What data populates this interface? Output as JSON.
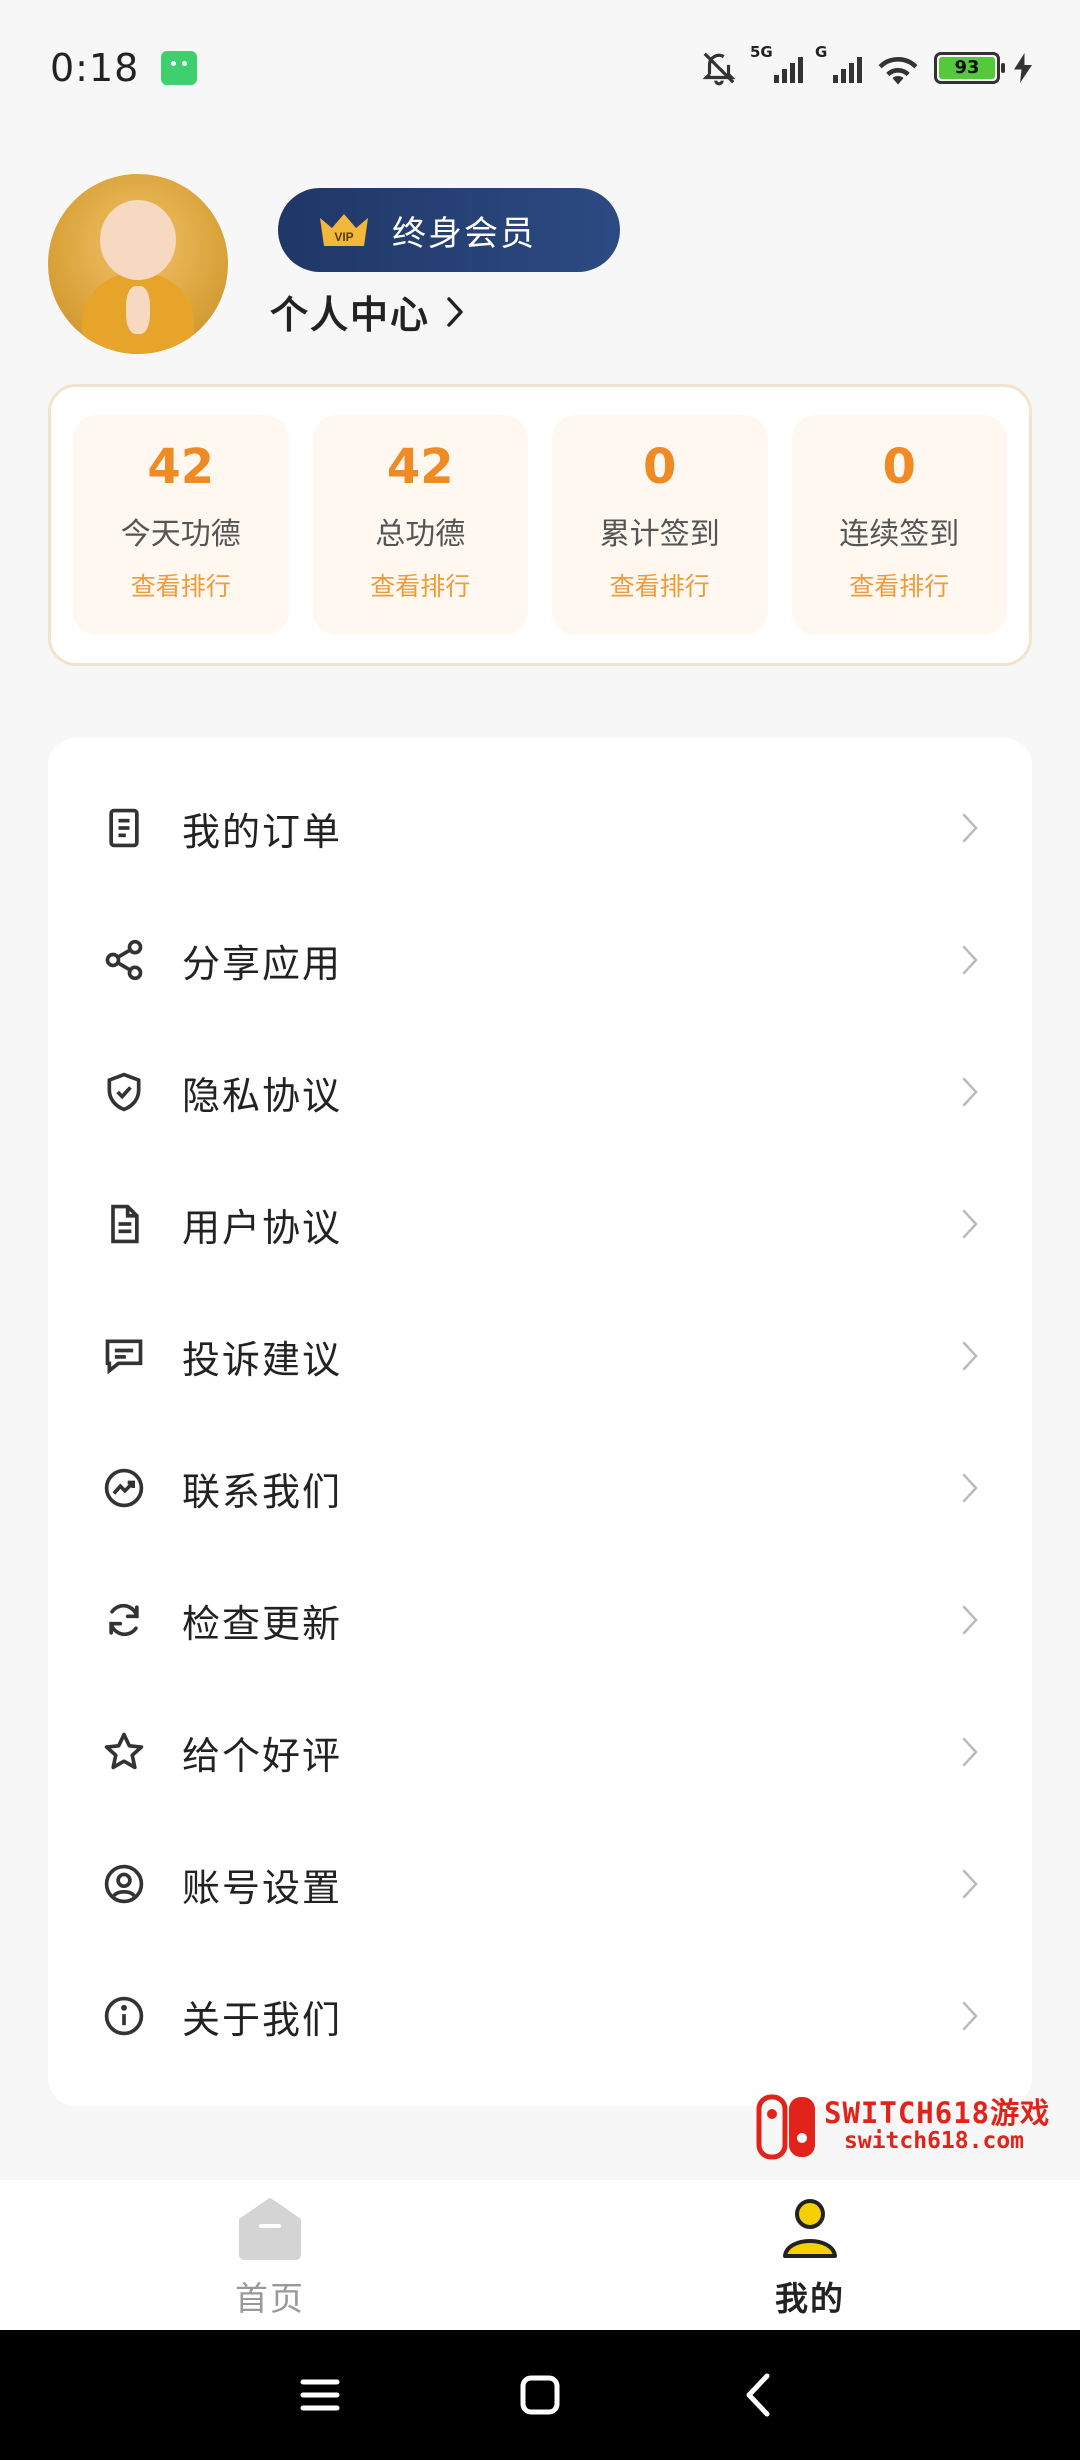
{
  "status_bar": {
    "time": "0:18",
    "signal1_label": "5G",
    "signal2_label": "G",
    "battery": "93"
  },
  "profile": {
    "vip_label": "终身会员",
    "center_label": "个人中心"
  },
  "stats": [
    {
      "value": "42",
      "label": "今天功德",
      "link": "查看排行"
    },
    {
      "value": "42",
      "label": "总功德",
      "link": "查看排行"
    },
    {
      "value": "0",
      "label": "累计签到",
      "link": "查看排行"
    },
    {
      "value": "0",
      "label": "连续签到",
      "link": "查看排行"
    }
  ],
  "menu": [
    {
      "label": "我的订单",
      "icon": "receipt-icon"
    },
    {
      "label": "分享应用",
      "icon": "share-icon"
    },
    {
      "label": "隐私协议",
      "icon": "shield-check-icon"
    },
    {
      "label": "用户协议",
      "icon": "document-icon"
    },
    {
      "label": "投诉建议",
      "icon": "message-icon"
    },
    {
      "label": "联系我们",
      "icon": "trend-circle-icon"
    },
    {
      "label": "检查更新",
      "icon": "refresh-icon"
    },
    {
      "label": "给个好评",
      "icon": "star-icon"
    },
    {
      "label": "账号设置",
      "icon": "user-circle-icon"
    },
    {
      "label": "关于我们",
      "icon": "info-icon"
    }
  ],
  "watermark": {
    "line1": "SWITCH618游戏",
    "line2": "switch618.com"
  },
  "tabs": {
    "home": "首页",
    "me": "我的"
  },
  "colors": {
    "accent": "#ef8a24",
    "vip_bg": "#1f3766",
    "active_tab": "#f5d000"
  }
}
